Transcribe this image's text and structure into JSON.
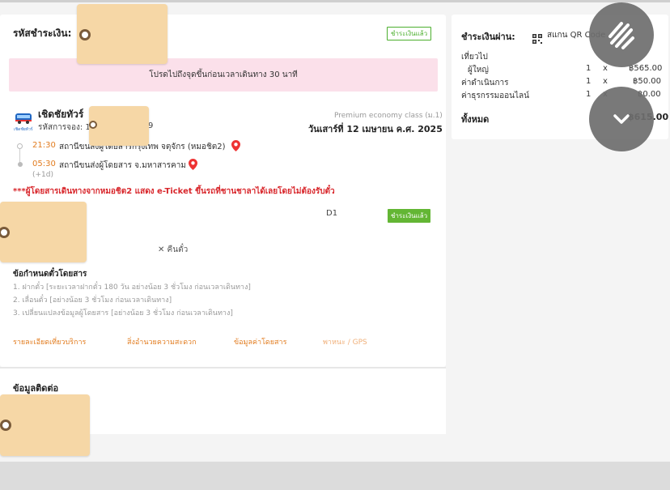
{
  "payment_code_label": "รหัสชำระเงิน:",
  "paid_badge": "ชำระเงินแล้ว",
  "notice_text": "โปรดไปถึงจุดขึ้นก่อนเวลาเดินทาง 30 นาที",
  "operator": {
    "name": "เชิดชัยทัวร์",
    "booking_label": "รหัสการจอง: 1",
    "booking_suffix": "9",
    "logo_caption": "เชิดชัยทัวร์",
    "class": "Premium economy class (ม.1)",
    "date": "วันเสาร์ที่ 12 เมษายน ค.ศ. 2025"
  },
  "trip": {
    "dep_time": "21:30",
    "dep_station": "สถานีขนส่งผู้โดยสารกรุงเทพ จตุจักร (หมอชิต2)",
    "arr_time": "05:30",
    "arr_station": "สถานีขนส่งผู้โดยสาร จ.มหาสารคาม",
    "day_offset": "(+1d)"
  },
  "warning": "***ผู้โดยสารเดินทางจากหมอชิต2 แสดง e-Ticket ขึ้นรถที่ชานชาลาได้เลยโดยไม่ต้องรับตั๋ว",
  "seat": "D1",
  "seat_badge": "ชำระเงินแล้ว",
  "refund": "✕ คืนตั๋ว",
  "rules": {
    "title": "ข้อกำหนดตั๋วโดยสาร",
    "items": [
      "1. ฝากตั๋ว [ระยะเวลาฝากตั๋ว 180 วัน อย่างน้อย 3 ชั่วโมง ก่อนเวลาเดินทาง]",
      "2. เลื่อนตั๋ว [อย่างน้อย 3 ชั่วโมง ก่อนเวลาเดินทาง]",
      "3. เปลี่ยนแปลงข้อมูลผู้โดยสาร [อย่างน้อย 3 ชั่วโมง ก่อนเวลาเดินทาง]"
    ]
  },
  "links": [
    "รายละเอียดเที่ยวบริการ",
    "สิ่งอำนวยความสะดวก",
    "ข้อมูลค่าโดยสาร",
    "พาหนะ / GPS"
  ],
  "contact_title": "ข้อมูลติดต่อ",
  "summary": {
    "pay_via_label": "ชำระเงินผ่าน:",
    "method": "สแกน QR Code",
    "trip_label": "เที่ยวไป",
    "rows": [
      {
        "label": "ผู้ใหญ่",
        "qty": "1",
        "x": "x",
        "amount": "฿565.00"
      },
      {
        "label": "ค่าดำเนินการ",
        "qty": "1",
        "x": "x",
        "amount": "฿50.00"
      },
      {
        "label": "ค่าธุรกรรมออนไลน์",
        "qty": "1",
        "x": "x",
        "amount": "฿0.00"
      }
    ],
    "total_label": "ทั้งหมด",
    "total": "฿615.00"
  },
  "colors": {
    "accent_orange": "#e27c1f",
    "paid_green": "#63b634",
    "notice_pink": "#fbe0ea",
    "warning_red": "#d8262b",
    "tag": "#f6d7a6"
  }
}
